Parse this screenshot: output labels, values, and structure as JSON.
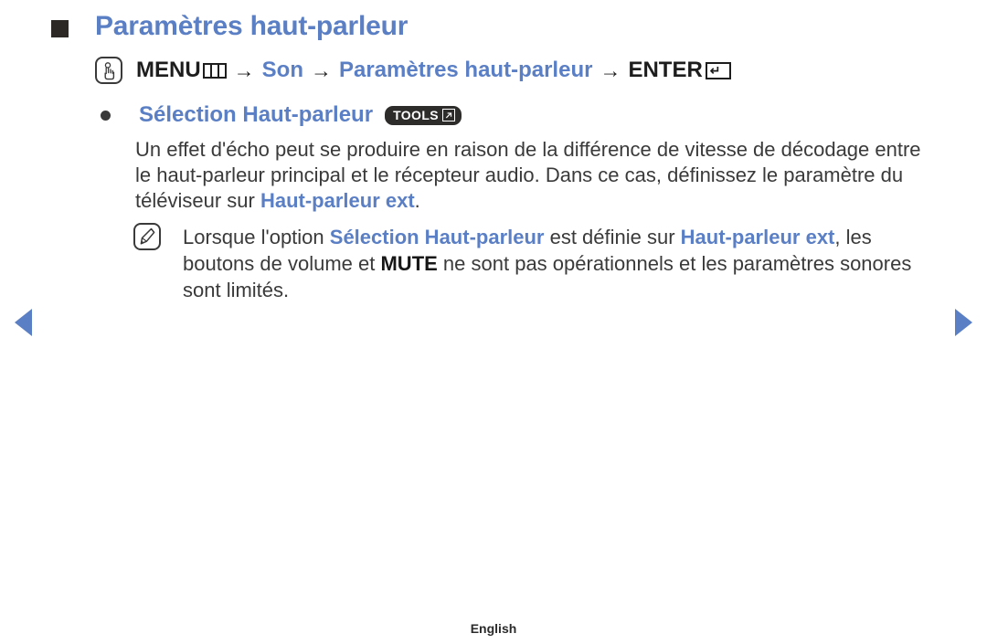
{
  "page": {
    "title": "Paramètres haut-parleur",
    "title_bullet_icon": "square-bullet-icon",
    "accent_color": "#5b7fc4",
    "text_color": "#3a3a3a",
    "badge_color": "#2e2c2b"
  },
  "menu_path": {
    "touch_icon": "hand-touch-icon",
    "menu_label": "MENU",
    "menu_glyph": "menu-grid-icon",
    "arrow1": "→",
    "son_label": "Son",
    "arrow2": "→",
    "settings_label": "Paramètres haut-parleur",
    "arrow3": "→",
    "enter_label": "ENTER",
    "enter_glyph": "↵"
  },
  "option": {
    "bullet_icon": "round-bullet-icon",
    "label": "Sélection Haut-parleur",
    "badge": {
      "label": "TOOLS",
      "icon": "tools-arrow-icon"
    }
  },
  "body": {
    "part1": "Un effet d'écho peut se produire en raison de la différence de vitesse de décodage entre le haut-parleur principal et le récepteur audio. Dans ce cas, définissez le paramètre du téléviseur sur ",
    "highlight1": "Haut-parleur ext",
    "part2": "."
  },
  "note": {
    "icon": "note-pencil-icon",
    "part1": "Lorsque l'option ",
    "highlight1": "Sélection Haut-parleur",
    "part2": " est définie sur ",
    "highlight2": "Haut-parleur ext",
    "part3": ", les boutons de volume et ",
    "strong1": "MUTE",
    "part4": " ne sont pas opérationnels et les paramètres sonores sont limités."
  },
  "navigation": {
    "prev_icon": "prev-arrow-icon",
    "next_icon": "next-arrow-icon"
  },
  "footer": {
    "language": "English"
  }
}
